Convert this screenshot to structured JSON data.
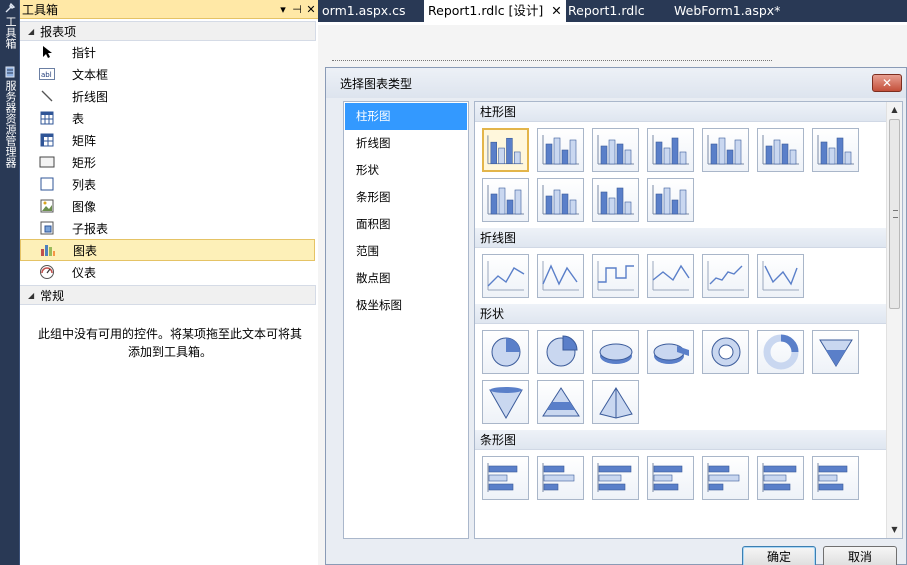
{
  "vertical_tabs": [
    "工具箱",
    "服务器资源管理器"
  ],
  "toolbox": {
    "title": "工具箱",
    "pin_glyph": "▾ ⊣",
    "close_glyph": "✕",
    "groups": [
      {
        "header": "报表项",
        "items": [
          {
            "label": "指针",
            "icon": "pointer-icon"
          },
          {
            "label": "文本框",
            "icon": "textbox-icon"
          },
          {
            "label": "折线图",
            "icon": "line-icon"
          },
          {
            "label": "表",
            "icon": "table-icon"
          },
          {
            "label": "矩阵",
            "icon": "matrix-icon"
          },
          {
            "label": "矩形",
            "icon": "rectangle-icon"
          },
          {
            "label": "列表",
            "icon": "list-icon"
          },
          {
            "label": "图像",
            "icon": "image-icon"
          },
          {
            "label": "子报表",
            "icon": "subreport-icon"
          },
          {
            "label": "图表",
            "icon": "chart-icon",
            "selected": true
          },
          {
            "label": "仪表",
            "icon": "gauge-icon"
          }
        ]
      },
      {
        "header": "常规",
        "empty_message": "此组中没有可用的控件。将某项拖至此文本可将其添加到工具箱。"
      }
    ]
  },
  "doc_tabs": [
    {
      "label": "orm1.aspx.cs",
      "active": false
    },
    {
      "label": "Report1.rdlc [设计]",
      "active": true,
      "close": "✕"
    },
    {
      "label": "Report1.rdlc",
      "active": false
    },
    {
      "label": "WebForm1.aspx*",
      "active": false
    }
  ],
  "dialog": {
    "title": "选择图表类型",
    "close_glyph": "✕",
    "categories": [
      "柱形图",
      "折线图",
      "形状",
      "条形图",
      "面积图",
      "范围",
      "散点图",
      "极坐标图"
    ],
    "selected_category": "柱形图",
    "sections": [
      {
        "header": "柱形图",
        "tile_count": 11,
        "tile_icon": "column-chart-icon"
      },
      {
        "header": "折线图",
        "tile_count": 6,
        "tile_icon": "line-chart-icon"
      },
      {
        "header": "形状",
        "tile_count": 10,
        "tile_icon": "shape-chart-icon"
      },
      {
        "header": "条形图",
        "tile_count": 7,
        "tile_icon": "bar-chart-icon"
      }
    ],
    "ok_label": "确定",
    "cancel_label": "取消"
  },
  "colors": {
    "chrome": "#293955",
    "selection_accent": "#3399ff",
    "toolbox_title_bg": "#ffe8a6",
    "selected_item_bg": "#fdf0b8",
    "chart_blue": "#5a7fc9"
  }
}
